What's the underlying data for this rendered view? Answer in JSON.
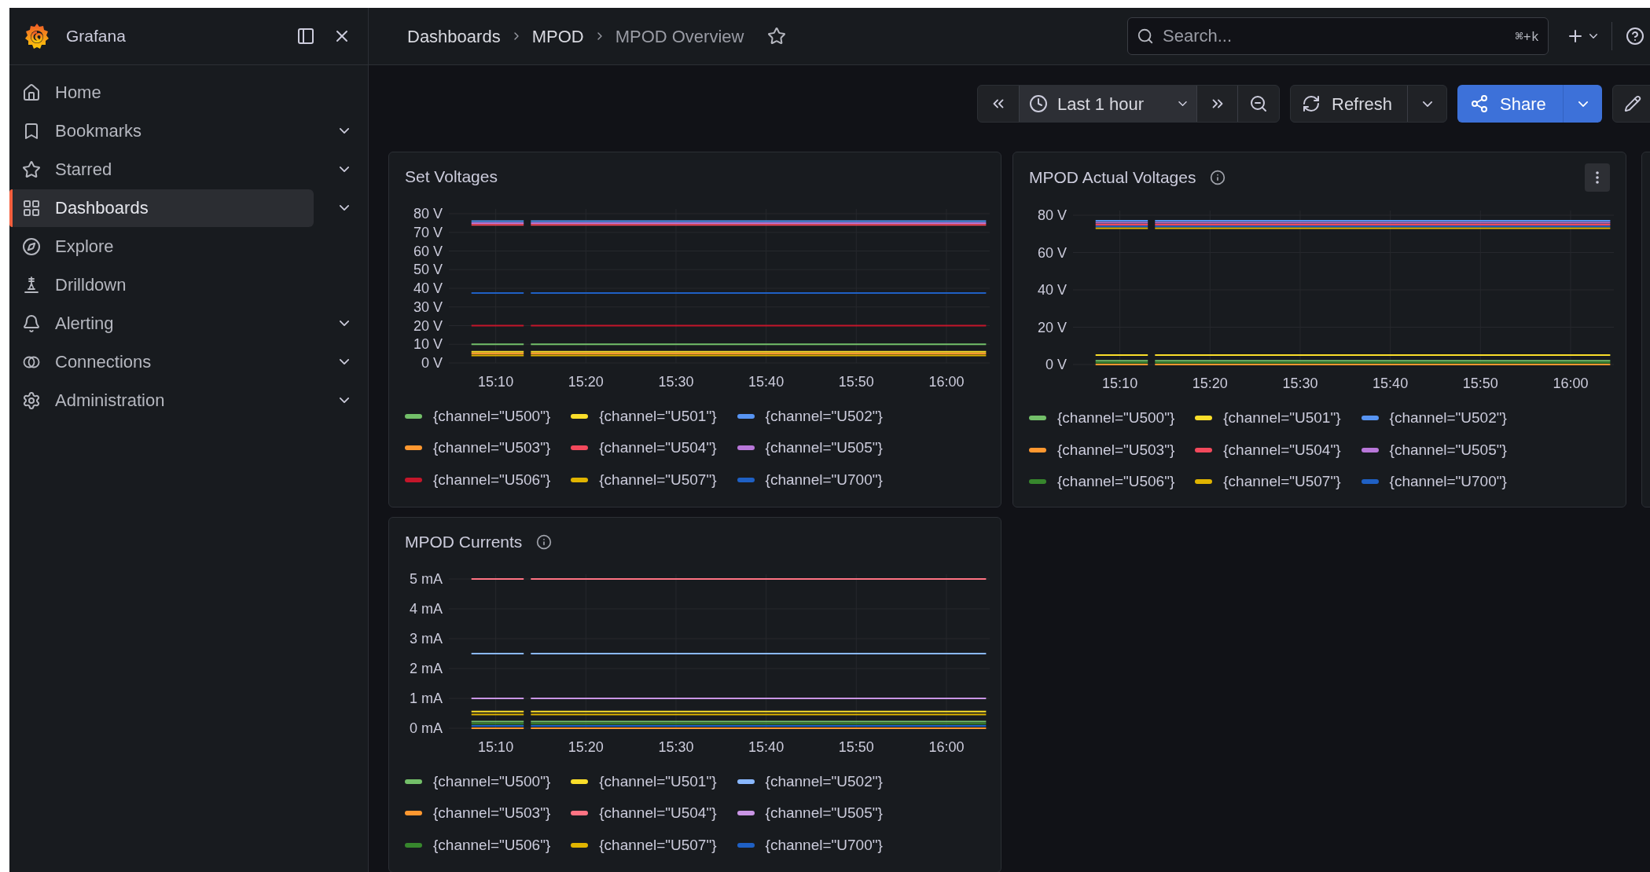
{
  "brand": {
    "name": "Grafana"
  },
  "sidebar": {
    "items": [
      {
        "label": "Home",
        "selected": false,
        "expandable": false
      },
      {
        "label": "Bookmarks",
        "selected": false,
        "expandable": true
      },
      {
        "label": "Starred",
        "selected": false,
        "expandable": true
      },
      {
        "label": "Dashboards",
        "selected": true,
        "expandable": true
      },
      {
        "label": "Explore",
        "selected": false,
        "expandable": false
      },
      {
        "label": "Drilldown",
        "selected": false,
        "expandable": false
      },
      {
        "label": "Alerting",
        "selected": false,
        "expandable": true
      },
      {
        "label": "Connections",
        "selected": false,
        "expandable": true
      },
      {
        "label": "Administration",
        "selected": false,
        "expandable": true
      }
    ]
  },
  "breadcrumbs": [
    "Dashboards",
    "MPOD",
    "MPOD Overview"
  ],
  "search": {
    "placeholder": "Search...",
    "shortcut": "⌘+k"
  },
  "toolbar": {
    "time_range": "Last 1 hour",
    "refresh": "Refresh",
    "share": "Share"
  },
  "panels": [
    {
      "title": "Set Voltages",
      "has_info": false,
      "menu_visible": false,
      "chart_data": {
        "type": "line",
        "grid": true,
        "x": [
          907.3,
          913.1,
          913.5,
          913.9,
          964.4
        ],
        "xlim": [
          904.8,
          964.8
        ],
        "ylim": [
          0,
          80
        ],
        "xticks": [
          {
            "value": 910,
            "label": "15:10"
          },
          {
            "value": 920,
            "label": "15:20"
          },
          {
            "value": 930,
            "label": "15:30"
          },
          {
            "value": 940,
            "label": "15:40"
          },
          {
            "value": 950,
            "label": "15:50"
          },
          {
            "value": 960,
            "label": "16:00"
          }
        ],
        "yticks": [
          {
            "value": 0,
            "label": "0 V"
          },
          {
            "value": 10,
            "label": "10 V"
          },
          {
            "value": 20,
            "label": "20 V"
          },
          {
            "value": 30,
            "label": "30 V"
          },
          {
            "value": 40,
            "label": "40 V"
          },
          {
            "value": 50,
            "label": "50 V"
          },
          {
            "value": 60,
            "label": "60 V"
          },
          {
            "value": 70,
            "label": "70 V"
          },
          {
            "value": 80,
            "label": "80 V"
          }
        ],
        "series": [
          {
            "name": "{channel=\"U500\"}",
            "color": "#73bf69",
            "values": [
              10,
              10,
              null,
              10,
              10
            ]
          },
          {
            "name": "{channel=\"U501\"}",
            "color": "#fade2a",
            "values": [
              6,
              6,
              null,
              6,
              6
            ]
          },
          {
            "name": "{channel=\"U502\"}",
            "color": "#5794f2",
            "values": [
              76,
              76,
              null,
              76,
              76
            ]
          },
          {
            "name": "{channel=\"U503\"}",
            "color": "#ff9830",
            "values": [
              5,
              5,
              null,
              5,
              5
            ]
          },
          {
            "name": "{channel=\"U504\"}",
            "color": "#f2495c",
            "values": [
              74,
              74,
              null,
              74,
              74
            ]
          },
          {
            "name": "{channel=\"U505\"}",
            "color": "#b877d9",
            "values": [
              75,
              75,
              null,
              75,
              75
            ]
          },
          {
            "name": "{channel=\"U506\"}",
            "color": "#c4162a",
            "values": [
              20,
              20,
              null,
              20,
              20
            ]
          },
          {
            "name": "{channel=\"U507\"}",
            "color": "#e0b400",
            "values": [
              4,
              4,
              null,
              4,
              4
            ]
          },
          {
            "name": "{channel=\"U700\"}",
            "color": "#1f60c4",
            "values": [
              37.5,
              37.5,
              null,
              37.5,
              37.5
            ]
          }
        ]
      }
    },
    {
      "title": "MPOD Actual Voltages",
      "has_info": true,
      "menu_visible": true,
      "chart_data": {
        "type": "line",
        "grid": true,
        "x": [
          907.3,
          913.1,
          913.5,
          913.9,
          964.4
        ],
        "xlim": [
          904.8,
          964.8
        ],
        "ylim": [
          0,
          80
        ],
        "xticks": [
          {
            "value": 910,
            "label": "15:10"
          },
          {
            "value": 920,
            "label": "15:20"
          },
          {
            "value": 930,
            "label": "15:30"
          },
          {
            "value": 940,
            "label": "15:40"
          },
          {
            "value": 950,
            "label": "15:50"
          },
          {
            "value": 960,
            "label": "16:00"
          }
        ],
        "yticks": [
          {
            "value": 0,
            "label": "0 V"
          },
          {
            "value": 20,
            "label": "20 V"
          },
          {
            "value": 40,
            "label": "40 V"
          },
          {
            "value": 60,
            "label": "60 V"
          },
          {
            "value": 80,
            "label": "80 V"
          }
        ],
        "series": [
          {
            "name": "{channel=\"U500\"}",
            "color": "#73bf69",
            "values": [
              2,
              2,
              null,
              2,
              2
            ]
          },
          {
            "name": "{channel=\"U501\"}",
            "color": "#fade2a",
            "values": [
              5,
              5,
              null,
              5,
              5
            ]
          },
          {
            "name": "{channel=\"U502\"}",
            "color": "#5794f2",
            "values": [
              77,
              77,
              null,
              77,
              77
            ]
          },
          {
            "name": "{channel=\"U503\"}",
            "color": "#ff9830",
            "values": [
              0,
              0,
              null,
              0,
              0
            ]
          },
          {
            "name": "{channel=\"U504\"}",
            "color": "#f2495c",
            "values": [
              75,
              75,
              null,
              75,
              75
            ]
          },
          {
            "name": "{channel=\"U505\"}",
            "color": "#b877d9",
            "values": [
              76,
              76,
              null,
              76,
              76
            ]
          },
          {
            "name": "{channel=\"U506\"}",
            "color": "#37872d",
            "values": [
              1,
              1,
              null,
              1,
              1
            ]
          },
          {
            "name": "{channel=\"U507\"}",
            "color": "#e0b400",
            "values": [
              73,
              73,
              null,
              73,
              73
            ]
          },
          {
            "name": "{channel=\"U700\"}",
            "color": "#1f60c4",
            "values": [
              74,
              74,
              null,
              74,
              74
            ]
          }
        ]
      }
    },
    {
      "title": "MPOD Currents",
      "has_info": true,
      "menu_visible": false,
      "chart_data": {
        "type": "line",
        "grid": true,
        "x": [
          907.3,
          913.1,
          913.5,
          913.9,
          964.4
        ],
        "xlim": [
          904.8,
          964.8
        ],
        "ylim": [
          0,
          5
        ],
        "xticks": [
          {
            "value": 910,
            "label": "15:10"
          },
          {
            "value": 920,
            "label": "15:20"
          },
          {
            "value": 930,
            "label": "15:30"
          },
          {
            "value": 940,
            "label": "15:40"
          },
          {
            "value": 950,
            "label": "15:50"
          },
          {
            "value": 960,
            "label": "16:00"
          }
        ],
        "yticks": [
          {
            "value": 0,
            "label": "0 mA"
          },
          {
            "value": 1,
            "label": "1 mA"
          },
          {
            "value": 2,
            "label": "2 mA"
          },
          {
            "value": 3,
            "label": "3 mA"
          },
          {
            "value": 4,
            "label": "4 mA"
          },
          {
            "value": 5,
            "label": "5 mA"
          }
        ],
        "series": [
          {
            "name": "{channel=\"U500\"}",
            "color": "#73bf69",
            "values": [
              0.22,
              0.22,
              null,
              0.22,
              0.22
            ]
          },
          {
            "name": "{channel=\"U501\"}",
            "color": "#fade2a",
            "values": [
              0.56,
              0.56,
              null,
              0.56,
              0.56
            ]
          },
          {
            "name": "{channel=\"U502\"}",
            "color": "#8ab8ff",
            "values": [
              2.5,
              2.5,
              null,
              2.5,
              2.5
            ]
          },
          {
            "name": "{channel=\"U503\"}",
            "color": "#ff9830",
            "values": [
              0,
              0,
              null,
              0,
              0
            ]
          },
          {
            "name": "{channel=\"U504\"}",
            "color": "#ff7383",
            "values": [
              5,
              5,
              null,
              5,
              5
            ]
          },
          {
            "name": "{channel=\"U505\"}",
            "color": "#ca95e5",
            "values": [
              1,
              1,
              null,
              1,
              1
            ]
          },
          {
            "name": "{channel=\"U506\"}",
            "color": "#37872d",
            "values": [
              0.15,
              0.15,
              null,
              0.15,
              0.15
            ]
          },
          {
            "name": "{channel=\"U507\"}",
            "color": "#e0b400",
            "values": [
              0.46,
              0.46,
              null,
              0.46,
              0.46
            ]
          },
          {
            "name": "{channel=\"U700\"}",
            "color": "#1f60c4",
            "values": [
              0.08,
              0.08,
              null,
              0.08,
              0.08
            ]
          }
        ]
      }
    }
  ]
}
